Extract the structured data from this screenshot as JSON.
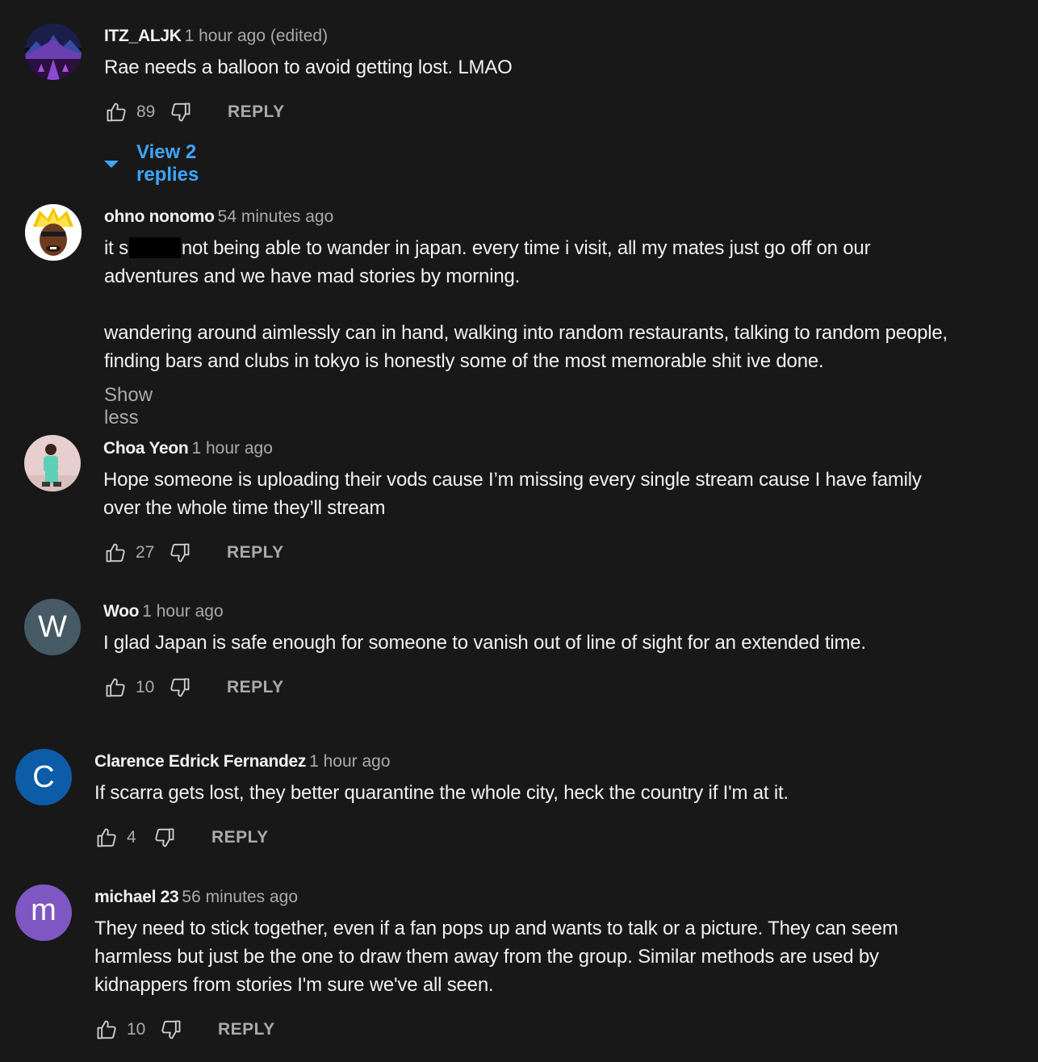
{
  "comments": [
    {
      "author": "ITZ_ALJK",
      "time": "1 hour ago (edited)",
      "lines": [
        "Rae needs a balloon to avoid getting lost. LMAO"
      ],
      "likes": "89",
      "reply_label": "REPLY",
      "view_replies": "View 2 replies"
    },
    {
      "author": "ohno nonomo",
      "time": "54 minutes ago",
      "line1_pre": "it s",
      "line1_post": "not being able to wander in japan. every time i visit, all my mates just go off on our",
      "lines": [
        "adventures and we have mad stories by morning.",
        "wandering around aimlessly can in hand, walking into random restaurants, talking to random people,",
        "finding bars and clubs in tokyo is honestly some of the most memorable shit ive done."
      ],
      "show_less": "Show less"
    },
    {
      "author": "Choa Yeon",
      "time": "1 hour ago",
      "lines": [
        "Hope someone is uploading their vods cause I’m missing every single stream cause I have family",
        "over the whole time they’ll stream"
      ],
      "likes": "27",
      "reply_label": "REPLY"
    },
    {
      "author": "Woo",
      "time": "1 hour ago",
      "avatar_letter": "W",
      "avatar_color": "#455a64",
      "lines": [
        "I glad Japan is safe enough for someone to vanish out of line of sight for an extended time."
      ],
      "likes": "10",
      "reply_label": "REPLY"
    },
    {
      "author": "Clarence Edrick Fernandez",
      "time": "1 hour ago",
      "avatar_letter": "C",
      "avatar_color": "#0d5ca8",
      "lines": [
        "If scarra gets lost, they better quarantine the whole city, heck the country if I'm at it."
      ],
      "likes": "4",
      "reply_label": "REPLY"
    },
    {
      "author": "michael 23",
      "time": "56 minutes ago",
      "avatar_letter": "m",
      "avatar_color": "#7e57c2",
      "lines": [
        "They need to stick together, even if a fan pops up and wants to talk or a picture. They can seem",
        "harmless but just be the one to draw them away from the group. Similar methods are used by",
        "kidnappers from stories I'm sure we've all seen."
      ],
      "likes": "10",
      "reply_label": "REPLY"
    }
  ],
  "icons": {
    "like": "thumbs-up-icon",
    "dislike": "thumbs-down-icon",
    "expand": "caret-down-icon"
  },
  "colors": {
    "background": "#181818",
    "primary_text": "#f1f1f1",
    "secondary_text": "#aaaaaa",
    "link": "#3ea6ff"
  }
}
